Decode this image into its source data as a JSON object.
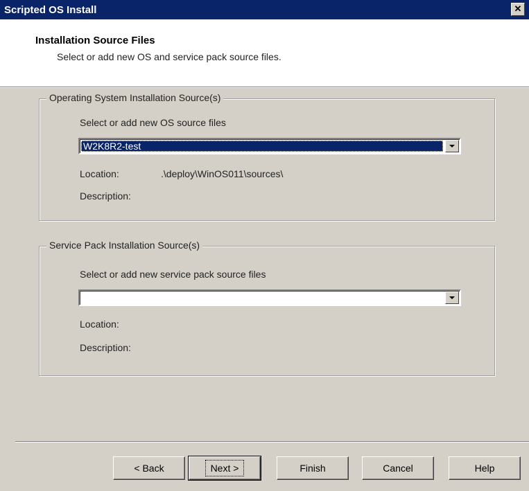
{
  "window": {
    "title": "Scripted OS Install",
    "close_glyph": "✕"
  },
  "header": {
    "title": "Installation Source Files",
    "subtitle": "Select or add new OS and service pack source files."
  },
  "os_group": {
    "legend": "Operating System Installation Source(s)",
    "prompt": "Select or add new OS source files",
    "selected": "W2K8R2-test",
    "location_label": "Location:",
    "location_value": ".\\deploy\\WinOS011\\sources\\",
    "description_label": "Description:"
  },
  "sp_group": {
    "legend": "Service Pack Installation Source(s)",
    "prompt": "Select or add new service pack source files",
    "selected": "",
    "location_label": "Location:",
    "description_label": "Description:"
  },
  "buttons": {
    "back": "< Back",
    "next": "Next >",
    "finish": "Finish",
    "cancel": "Cancel",
    "help": "Help"
  }
}
